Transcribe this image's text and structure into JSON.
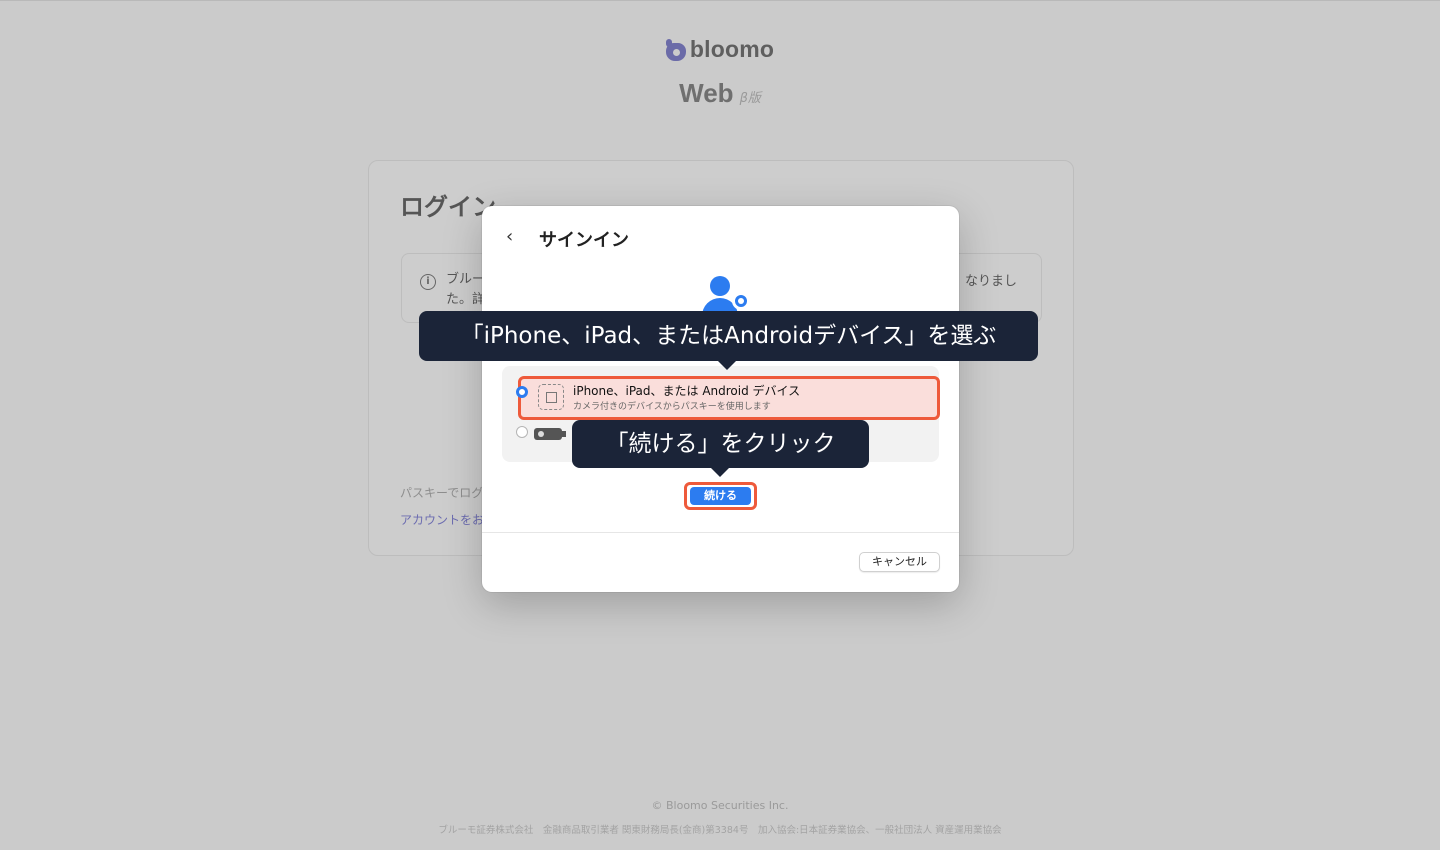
{
  "brand": {
    "name": "bloomo",
    "web": "Web",
    "beta": "β版"
  },
  "login": {
    "title": "ログイン",
    "notice_left": "ブルー た。詳",
    "notice_right": "なりまし",
    "passkey_text": "パスキーでログ",
    "account_link": "アカウントをお"
  },
  "dialog": {
    "title": "サインイン",
    "back_icon": "chevron-left-icon",
    "option1": {
      "label": "iPhone、iPad、または Android デバイス",
      "sub": "カメラ付きのデバイスからパスキーを使用します",
      "selected": true
    },
    "option2": {
      "selected": false
    },
    "continue_label": "続ける",
    "cancel_label": "キャンセル"
  },
  "callouts": {
    "step1": "「iPhone、iPad、またはAndroidデバイス」を選ぶ",
    "step2": "「続ける」をクリック"
  },
  "footer": {
    "copyright": "© Bloomo Securities Inc.",
    "legal": "ブルーモ証券株式会社　金融商品取引業者 関東財務局長(金商)第3384号　加入協会:日本証券業協会、一般社団法人 資産運用業協会"
  },
  "colors": {
    "accent": "#2c7cf0",
    "highlight_border": "#ee5a3b",
    "callout_bg": "#1b2438",
    "overlay_bg": "#cbcbcb"
  }
}
